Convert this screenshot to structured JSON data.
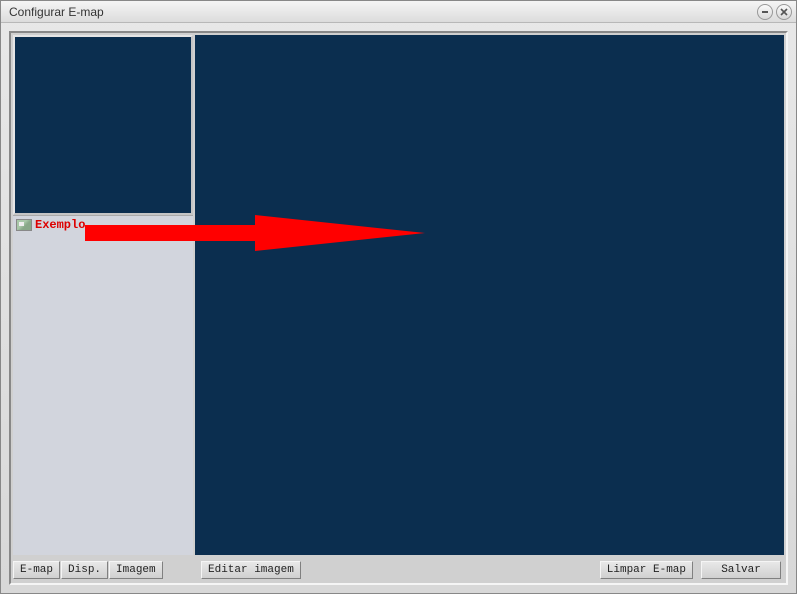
{
  "window": {
    "title": "Configurar E-map"
  },
  "tree": {
    "items": [
      {
        "label": "Exemplo"
      }
    ]
  },
  "toolbar": {
    "emap": "E-map",
    "disp": "Disp.",
    "imagem": "Imagem",
    "editar_imagem": "Editar imagem",
    "limpar_emap": "Limpar E-map",
    "salvar": "Salvar"
  },
  "colors": {
    "canvas_bg": "#0b2e4f",
    "annotation": "#ff0000"
  }
}
